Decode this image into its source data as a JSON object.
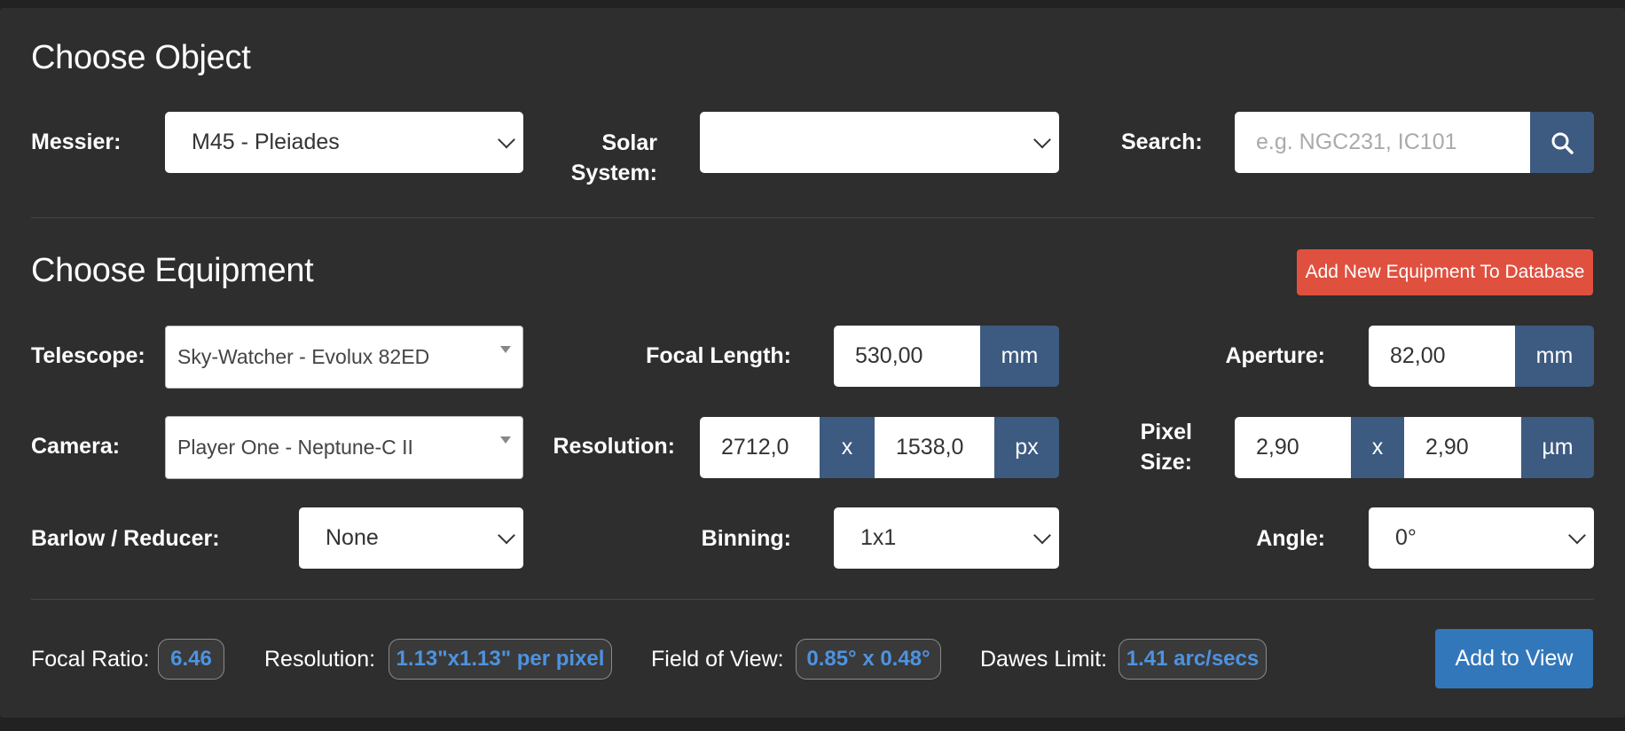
{
  "choose_object": {
    "title": "Choose Object",
    "messier_label": "Messier:",
    "messier_value": "M45 - Pleiades",
    "solar_label_line1": "Solar",
    "solar_label_line2": "System:",
    "solar_value": "",
    "search_label": "Search:",
    "search_placeholder": "e.g. NGC231, IC101"
  },
  "choose_equipment": {
    "title": "Choose Equipment",
    "add_button": "Add New Equipment To Database",
    "telescope_label": "Telescope:",
    "telescope_value": "Sky-Watcher - Evolux 82ED",
    "focal_length_label": "Focal Length:",
    "focal_length_value": "530,00",
    "focal_length_unit": "mm",
    "aperture_label": "Aperture:",
    "aperture_value": "82,00",
    "aperture_unit": "mm",
    "camera_label": "Camera:",
    "camera_value": "Player One - Neptune-C II",
    "resolution_label": "Resolution:",
    "resolution_x": "2712,0",
    "resolution_sep": "x",
    "resolution_y": "1538,0",
    "resolution_unit": "px",
    "pixel_size_label_line1": "Pixel",
    "pixel_size_label_line2": "Size:",
    "pixel_x": "2,90",
    "pixel_sep": "x",
    "pixel_y": "2,90",
    "pixel_unit": "µm",
    "barlow_label": "Barlow / Reducer:",
    "barlow_value": "None",
    "binning_label": "Binning:",
    "binning_value": "1x1",
    "angle_label": "Angle:",
    "angle_value": "0°"
  },
  "stats": {
    "focal_ratio_label": "Focal Ratio:",
    "focal_ratio_value": "6.46",
    "resolution_label": "Resolution:",
    "resolution_value": "1.13\"x1.13\" per pixel",
    "fov_label": "Field of View:",
    "fov_value": "0.85° x 0.48°",
    "dawes_label": "Dawes Limit:",
    "dawes_value": "1.41 arc/secs",
    "add_to_view": "Add to View"
  },
  "colors": {
    "panel_bg": "#2e2e2e",
    "addon_blue": "#3d5a80",
    "danger_red": "#e0503f",
    "primary_blue": "#3377bb",
    "badge_text": "#4d93e0"
  },
  "icons": {
    "search": "search-icon"
  }
}
